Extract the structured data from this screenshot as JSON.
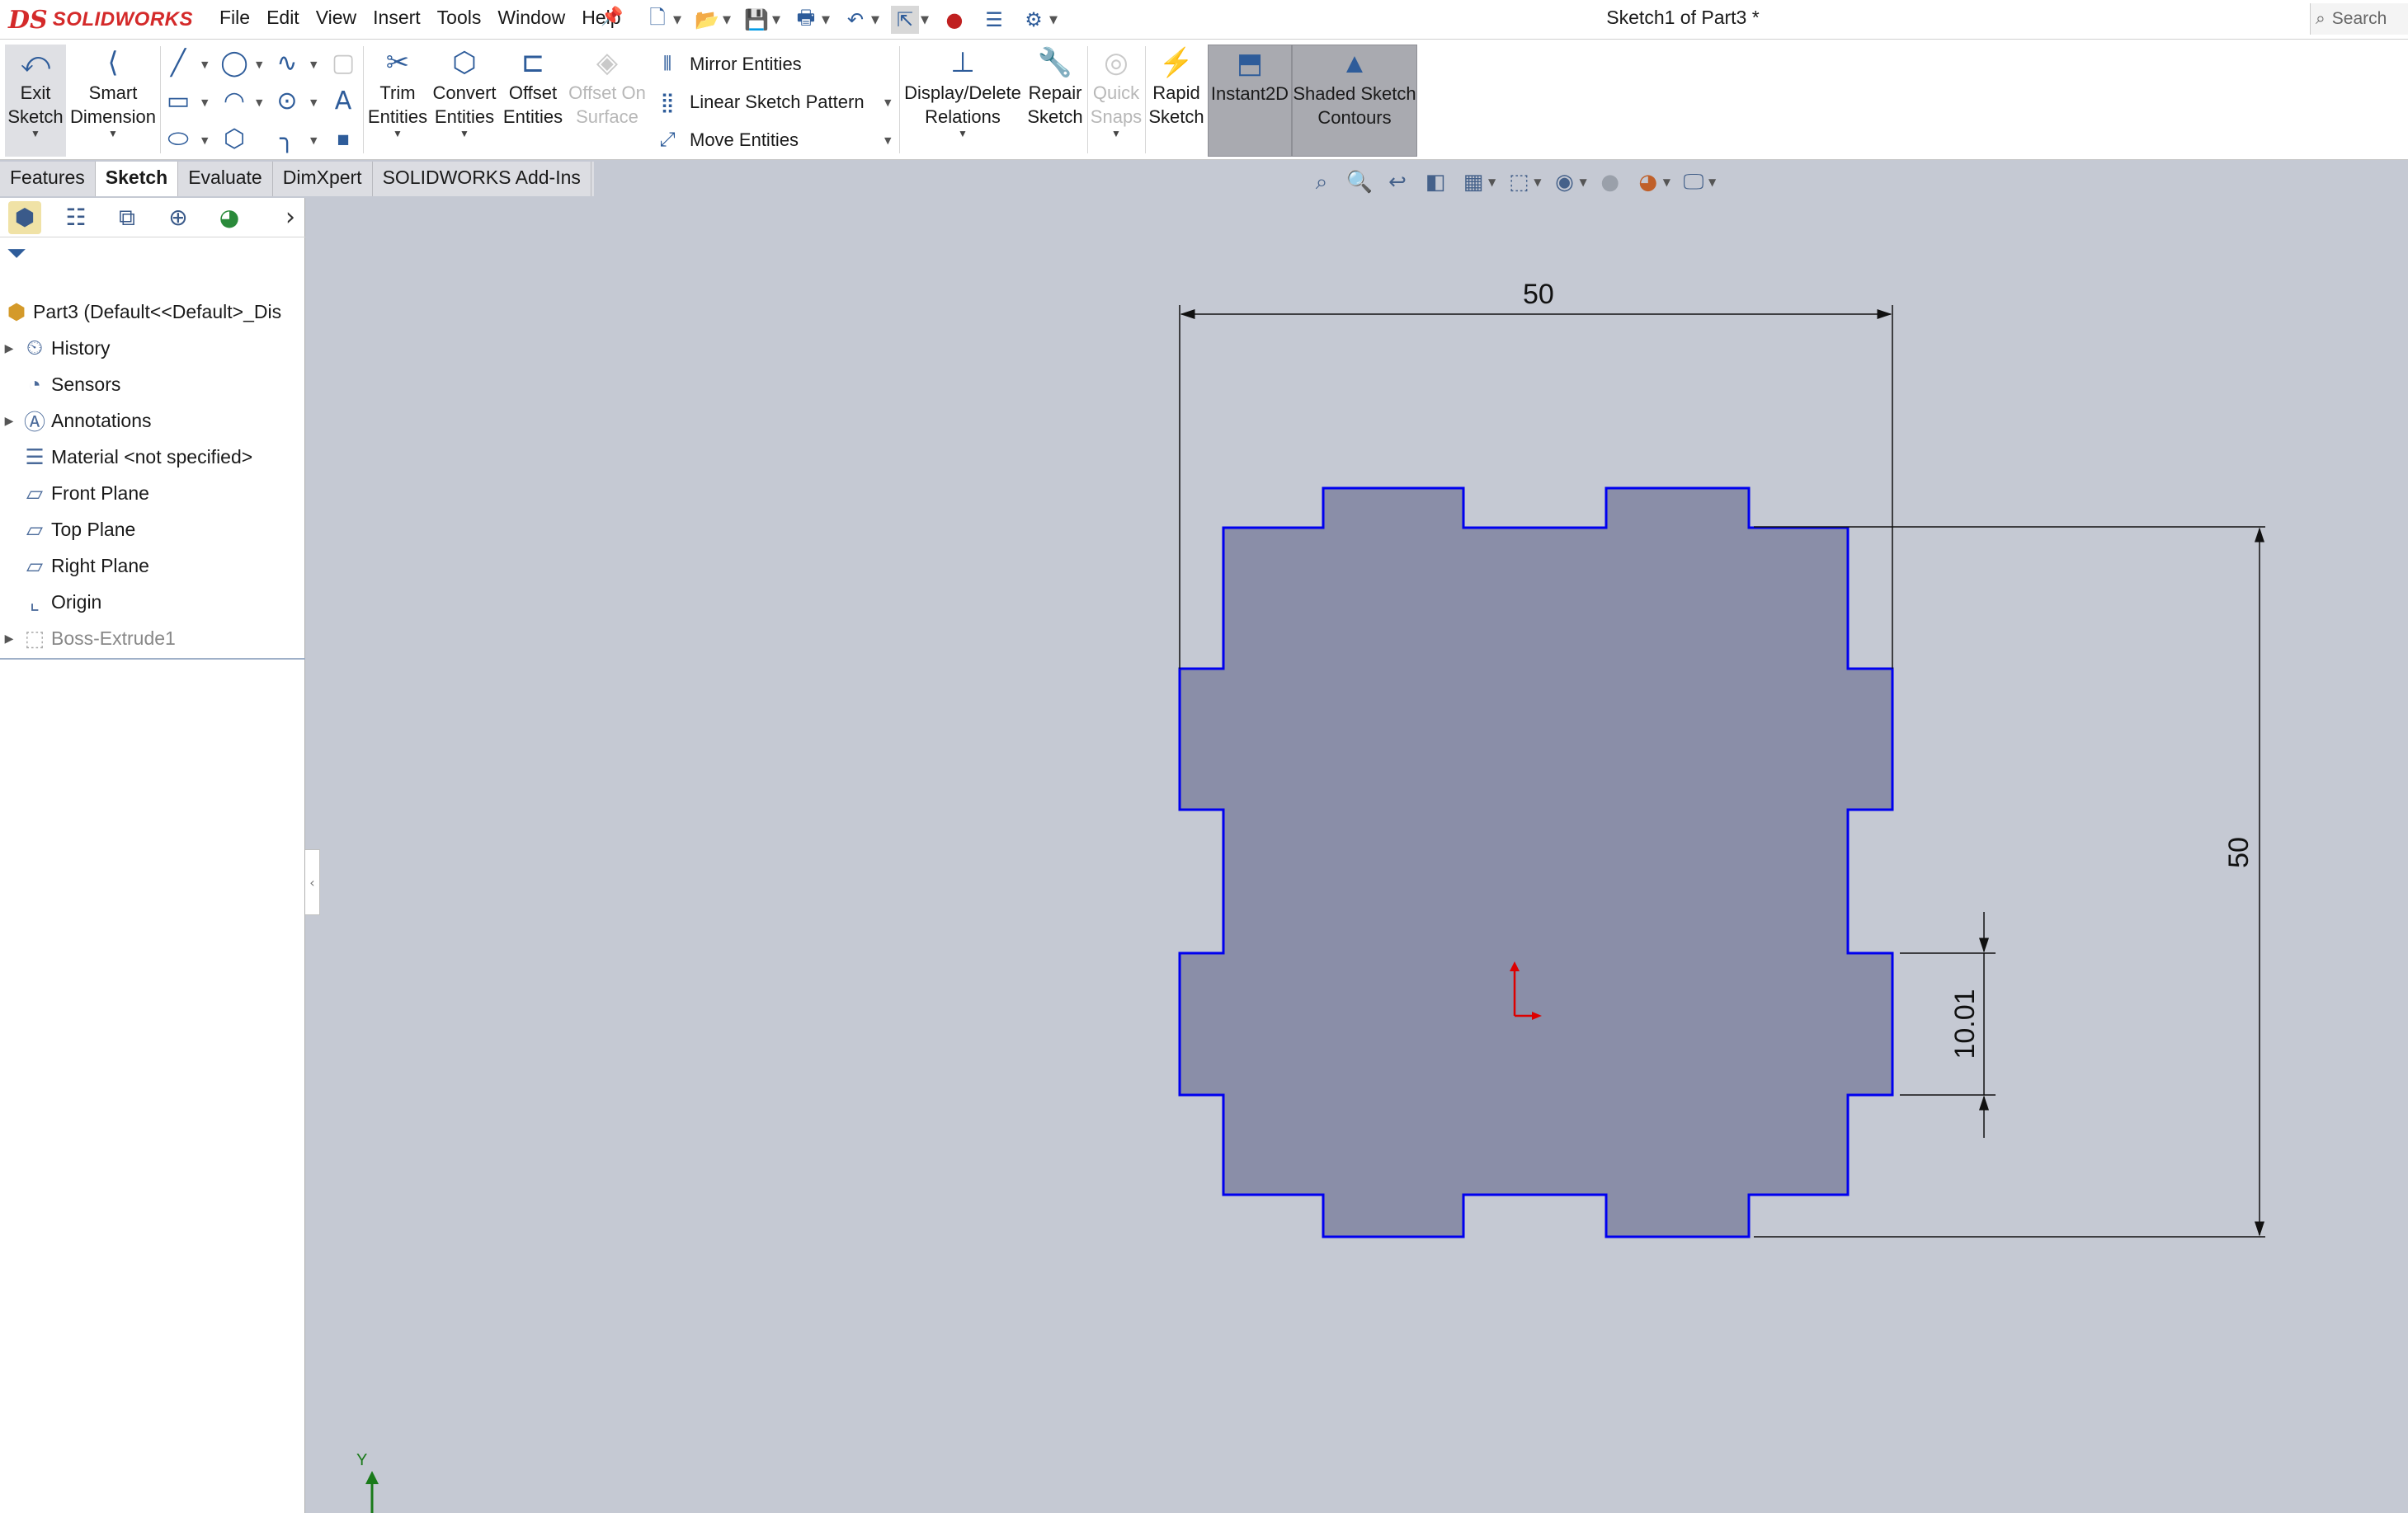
{
  "app": {
    "brand_prefix": "DS",
    "brand_name": "SOLIDWORKS",
    "document_title": "Sketch1 of Part3 *"
  },
  "menu": [
    "File",
    "Edit",
    "View",
    "Insert",
    "Tools",
    "Window",
    "Help"
  ],
  "search": {
    "placeholder": "Search"
  },
  "command_manager": {
    "exit_sketch": [
      "Exit",
      "Sketch"
    ],
    "smart_dimension": [
      "Smart",
      "Dimension"
    ],
    "trim_entities": [
      "Trim",
      "Entities"
    ],
    "convert_entities": [
      "Convert",
      "Entities"
    ],
    "offset_entities": [
      "Offset",
      "Entities"
    ],
    "offset_on_surface": [
      "Offset On",
      "Surface"
    ],
    "mirror_entities": "Mirror Entities",
    "linear_sketch_pattern": "Linear Sketch Pattern",
    "move_entities": "Move Entities",
    "display_delete_relations": [
      "Display/Delete",
      "Relations"
    ],
    "repair_sketch": [
      "Repair",
      "Sketch"
    ],
    "quick_snaps": [
      "Quick",
      "Snaps"
    ],
    "rapid_sketch": [
      "Rapid",
      "Sketch"
    ],
    "instant2d": "Instant2D",
    "shaded_sketch_contours": [
      "Shaded Sketch",
      "Contours"
    ]
  },
  "tabs": [
    {
      "label": "Features",
      "selected": false
    },
    {
      "label": "Sketch",
      "selected": true
    },
    {
      "label": "Evaluate",
      "selected": false
    },
    {
      "label": "DimXpert",
      "selected": false
    },
    {
      "label": "SOLIDWORKS Add-Ins",
      "selected": false
    }
  ],
  "feature_tree": {
    "root": "Part3  (Default<<Default>_Dis",
    "items": [
      {
        "label": "History",
        "icon": "history-icon",
        "expandable": true
      },
      {
        "label": "Sensors",
        "icon": "sensors-icon",
        "expandable": false
      },
      {
        "label": "Annotations",
        "icon": "annotations-icon",
        "expandable": true
      },
      {
        "label": "Material <not specified>",
        "icon": "material-icon",
        "expandable": false
      },
      {
        "label": "Front Plane",
        "icon": "plane-icon",
        "expandable": false
      },
      {
        "label": "Top Plane",
        "icon": "plane-icon",
        "expandable": false
      },
      {
        "label": "Right Plane",
        "icon": "plane-icon",
        "expandable": false
      },
      {
        "label": "Origin",
        "icon": "origin-icon",
        "expandable": false
      },
      {
        "label": "Boss-Extrude1",
        "icon": "boss-extrude-icon",
        "expandable": true,
        "suppressed": true
      }
    ]
  },
  "sketch": {
    "dim_width": "50",
    "dim_height": "50",
    "dim_tab": "10.01",
    "triad_y_label": "Y",
    "colors": {
      "outline": "#0000ee",
      "fill": "#8a8ea8",
      "dimension": "#111111",
      "origin": "#dd0000"
    }
  }
}
